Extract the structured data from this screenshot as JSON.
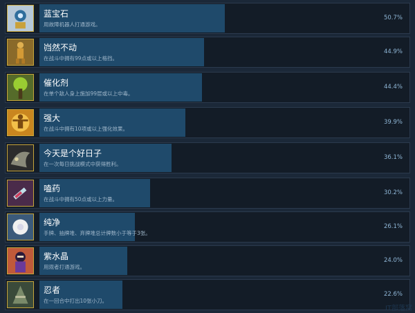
{
  "achievements": [
    {
      "name": "蓝宝石",
      "description": "用故障机器人打通游戏。",
      "percent": "50.7%",
      "fill": 0.507,
      "icon": "sapphire-robot-icon"
    },
    {
      "name": "岿然不动",
      "description": "在战斗中拥有99点或以上格挡。",
      "percent": "44.9%",
      "fill": 0.449,
      "icon": "immovable-icon"
    },
    {
      "name": "催化剂",
      "description": "在单个敌人身上施加99层或以上中毒。",
      "percent": "44.4%",
      "fill": 0.444,
      "icon": "catalyst-tree-icon"
    },
    {
      "name": "强大",
      "description": "在战斗中拥有10项或以上强化效果。",
      "percent": "39.9%",
      "fill": 0.399,
      "icon": "powerful-icon"
    },
    {
      "name": "今天是个好日子",
      "description": "在一次每日挑战模式中获得胜利。",
      "percent": "36.1%",
      "fill": 0.361,
      "icon": "good-day-icon"
    },
    {
      "name": "嗑药",
      "description": "在战斗中拥有50点或以上力量。",
      "percent": "30.2%",
      "fill": 0.302,
      "icon": "syringe-icon"
    },
    {
      "name": "纯净",
      "description": "手牌、抽牌堆、弃牌堆总计牌数小于等于3张。",
      "percent": "26.1%",
      "fill": 0.261,
      "icon": "pure-flower-icon"
    },
    {
      "name": "紫水晶",
      "description": "用观者打通游戏。",
      "percent": "24.0%",
      "fill": 0.24,
      "icon": "amethyst-watcher-icon"
    },
    {
      "name": "忍者",
      "description": "在一回合中打出10张小刀。",
      "percent": "22.6%",
      "fill": 0.226,
      "icon": "ninja-icon"
    }
  ],
  "watermark": "IT部落窝",
  "colors": {
    "background": "#1b2838",
    "row": "#131c27",
    "bar": "#1f4a6b",
    "percent": "#8fb6d6"
  }
}
